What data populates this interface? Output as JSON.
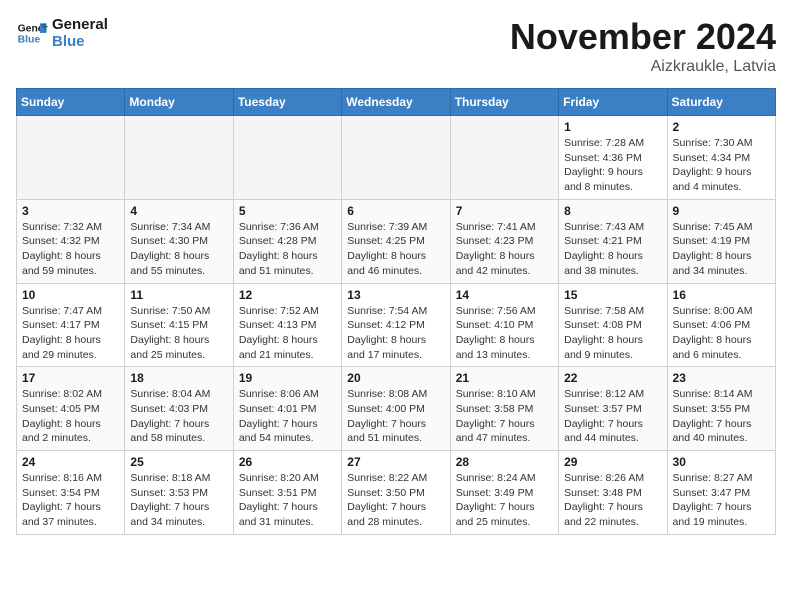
{
  "logo": {
    "line1": "General",
    "line2": "Blue"
  },
  "title": "November 2024",
  "location": "Aizkraukle, Latvia",
  "weekdays": [
    "Sunday",
    "Monday",
    "Tuesday",
    "Wednesday",
    "Thursday",
    "Friday",
    "Saturday"
  ],
  "weeks": [
    [
      {
        "day": "",
        "empty": true
      },
      {
        "day": "",
        "empty": true
      },
      {
        "day": "",
        "empty": true
      },
      {
        "day": "",
        "empty": true
      },
      {
        "day": "",
        "empty": true
      },
      {
        "day": "1",
        "sunrise": "7:28 AM",
        "sunset": "4:36 PM",
        "daylight": "9 hours and 8 minutes."
      },
      {
        "day": "2",
        "sunrise": "7:30 AM",
        "sunset": "4:34 PM",
        "daylight": "9 hours and 4 minutes."
      }
    ],
    [
      {
        "day": "3",
        "sunrise": "7:32 AM",
        "sunset": "4:32 PM",
        "daylight": "8 hours and 59 minutes."
      },
      {
        "day": "4",
        "sunrise": "7:34 AM",
        "sunset": "4:30 PM",
        "daylight": "8 hours and 55 minutes."
      },
      {
        "day": "5",
        "sunrise": "7:36 AM",
        "sunset": "4:28 PM",
        "daylight": "8 hours and 51 minutes."
      },
      {
        "day": "6",
        "sunrise": "7:39 AM",
        "sunset": "4:25 PM",
        "daylight": "8 hours and 46 minutes."
      },
      {
        "day": "7",
        "sunrise": "7:41 AM",
        "sunset": "4:23 PM",
        "daylight": "8 hours and 42 minutes."
      },
      {
        "day": "8",
        "sunrise": "7:43 AM",
        "sunset": "4:21 PM",
        "daylight": "8 hours and 38 minutes."
      },
      {
        "day": "9",
        "sunrise": "7:45 AM",
        "sunset": "4:19 PM",
        "daylight": "8 hours and 34 minutes."
      }
    ],
    [
      {
        "day": "10",
        "sunrise": "7:47 AM",
        "sunset": "4:17 PM",
        "daylight": "8 hours and 29 minutes."
      },
      {
        "day": "11",
        "sunrise": "7:50 AM",
        "sunset": "4:15 PM",
        "daylight": "8 hours and 25 minutes."
      },
      {
        "day": "12",
        "sunrise": "7:52 AM",
        "sunset": "4:13 PM",
        "daylight": "8 hours and 21 minutes."
      },
      {
        "day": "13",
        "sunrise": "7:54 AM",
        "sunset": "4:12 PM",
        "daylight": "8 hours and 17 minutes."
      },
      {
        "day": "14",
        "sunrise": "7:56 AM",
        "sunset": "4:10 PM",
        "daylight": "8 hours and 13 minutes."
      },
      {
        "day": "15",
        "sunrise": "7:58 AM",
        "sunset": "4:08 PM",
        "daylight": "8 hours and 9 minutes."
      },
      {
        "day": "16",
        "sunrise": "8:00 AM",
        "sunset": "4:06 PM",
        "daylight": "8 hours and 6 minutes."
      }
    ],
    [
      {
        "day": "17",
        "sunrise": "8:02 AM",
        "sunset": "4:05 PM",
        "daylight": "8 hours and 2 minutes."
      },
      {
        "day": "18",
        "sunrise": "8:04 AM",
        "sunset": "4:03 PM",
        "daylight": "7 hours and 58 minutes."
      },
      {
        "day": "19",
        "sunrise": "8:06 AM",
        "sunset": "4:01 PM",
        "daylight": "7 hours and 54 minutes."
      },
      {
        "day": "20",
        "sunrise": "8:08 AM",
        "sunset": "4:00 PM",
        "daylight": "7 hours and 51 minutes."
      },
      {
        "day": "21",
        "sunrise": "8:10 AM",
        "sunset": "3:58 PM",
        "daylight": "7 hours and 47 minutes."
      },
      {
        "day": "22",
        "sunrise": "8:12 AM",
        "sunset": "3:57 PM",
        "daylight": "7 hours and 44 minutes."
      },
      {
        "day": "23",
        "sunrise": "8:14 AM",
        "sunset": "3:55 PM",
        "daylight": "7 hours and 40 minutes."
      }
    ],
    [
      {
        "day": "24",
        "sunrise": "8:16 AM",
        "sunset": "3:54 PM",
        "daylight": "7 hours and 37 minutes."
      },
      {
        "day": "25",
        "sunrise": "8:18 AM",
        "sunset": "3:53 PM",
        "daylight": "7 hours and 34 minutes."
      },
      {
        "day": "26",
        "sunrise": "8:20 AM",
        "sunset": "3:51 PM",
        "daylight": "7 hours and 31 minutes."
      },
      {
        "day": "27",
        "sunrise": "8:22 AM",
        "sunset": "3:50 PM",
        "daylight": "7 hours and 28 minutes."
      },
      {
        "day": "28",
        "sunrise": "8:24 AM",
        "sunset": "3:49 PM",
        "daylight": "7 hours and 25 minutes."
      },
      {
        "day": "29",
        "sunrise": "8:26 AM",
        "sunset": "3:48 PM",
        "daylight": "7 hours and 22 minutes."
      },
      {
        "day": "30",
        "sunrise": "8:27 AM",
        "sunset": "3:47 PM",
        "daylight": "7 hours and 19 minutes."
      }
    ]
  ]
}
